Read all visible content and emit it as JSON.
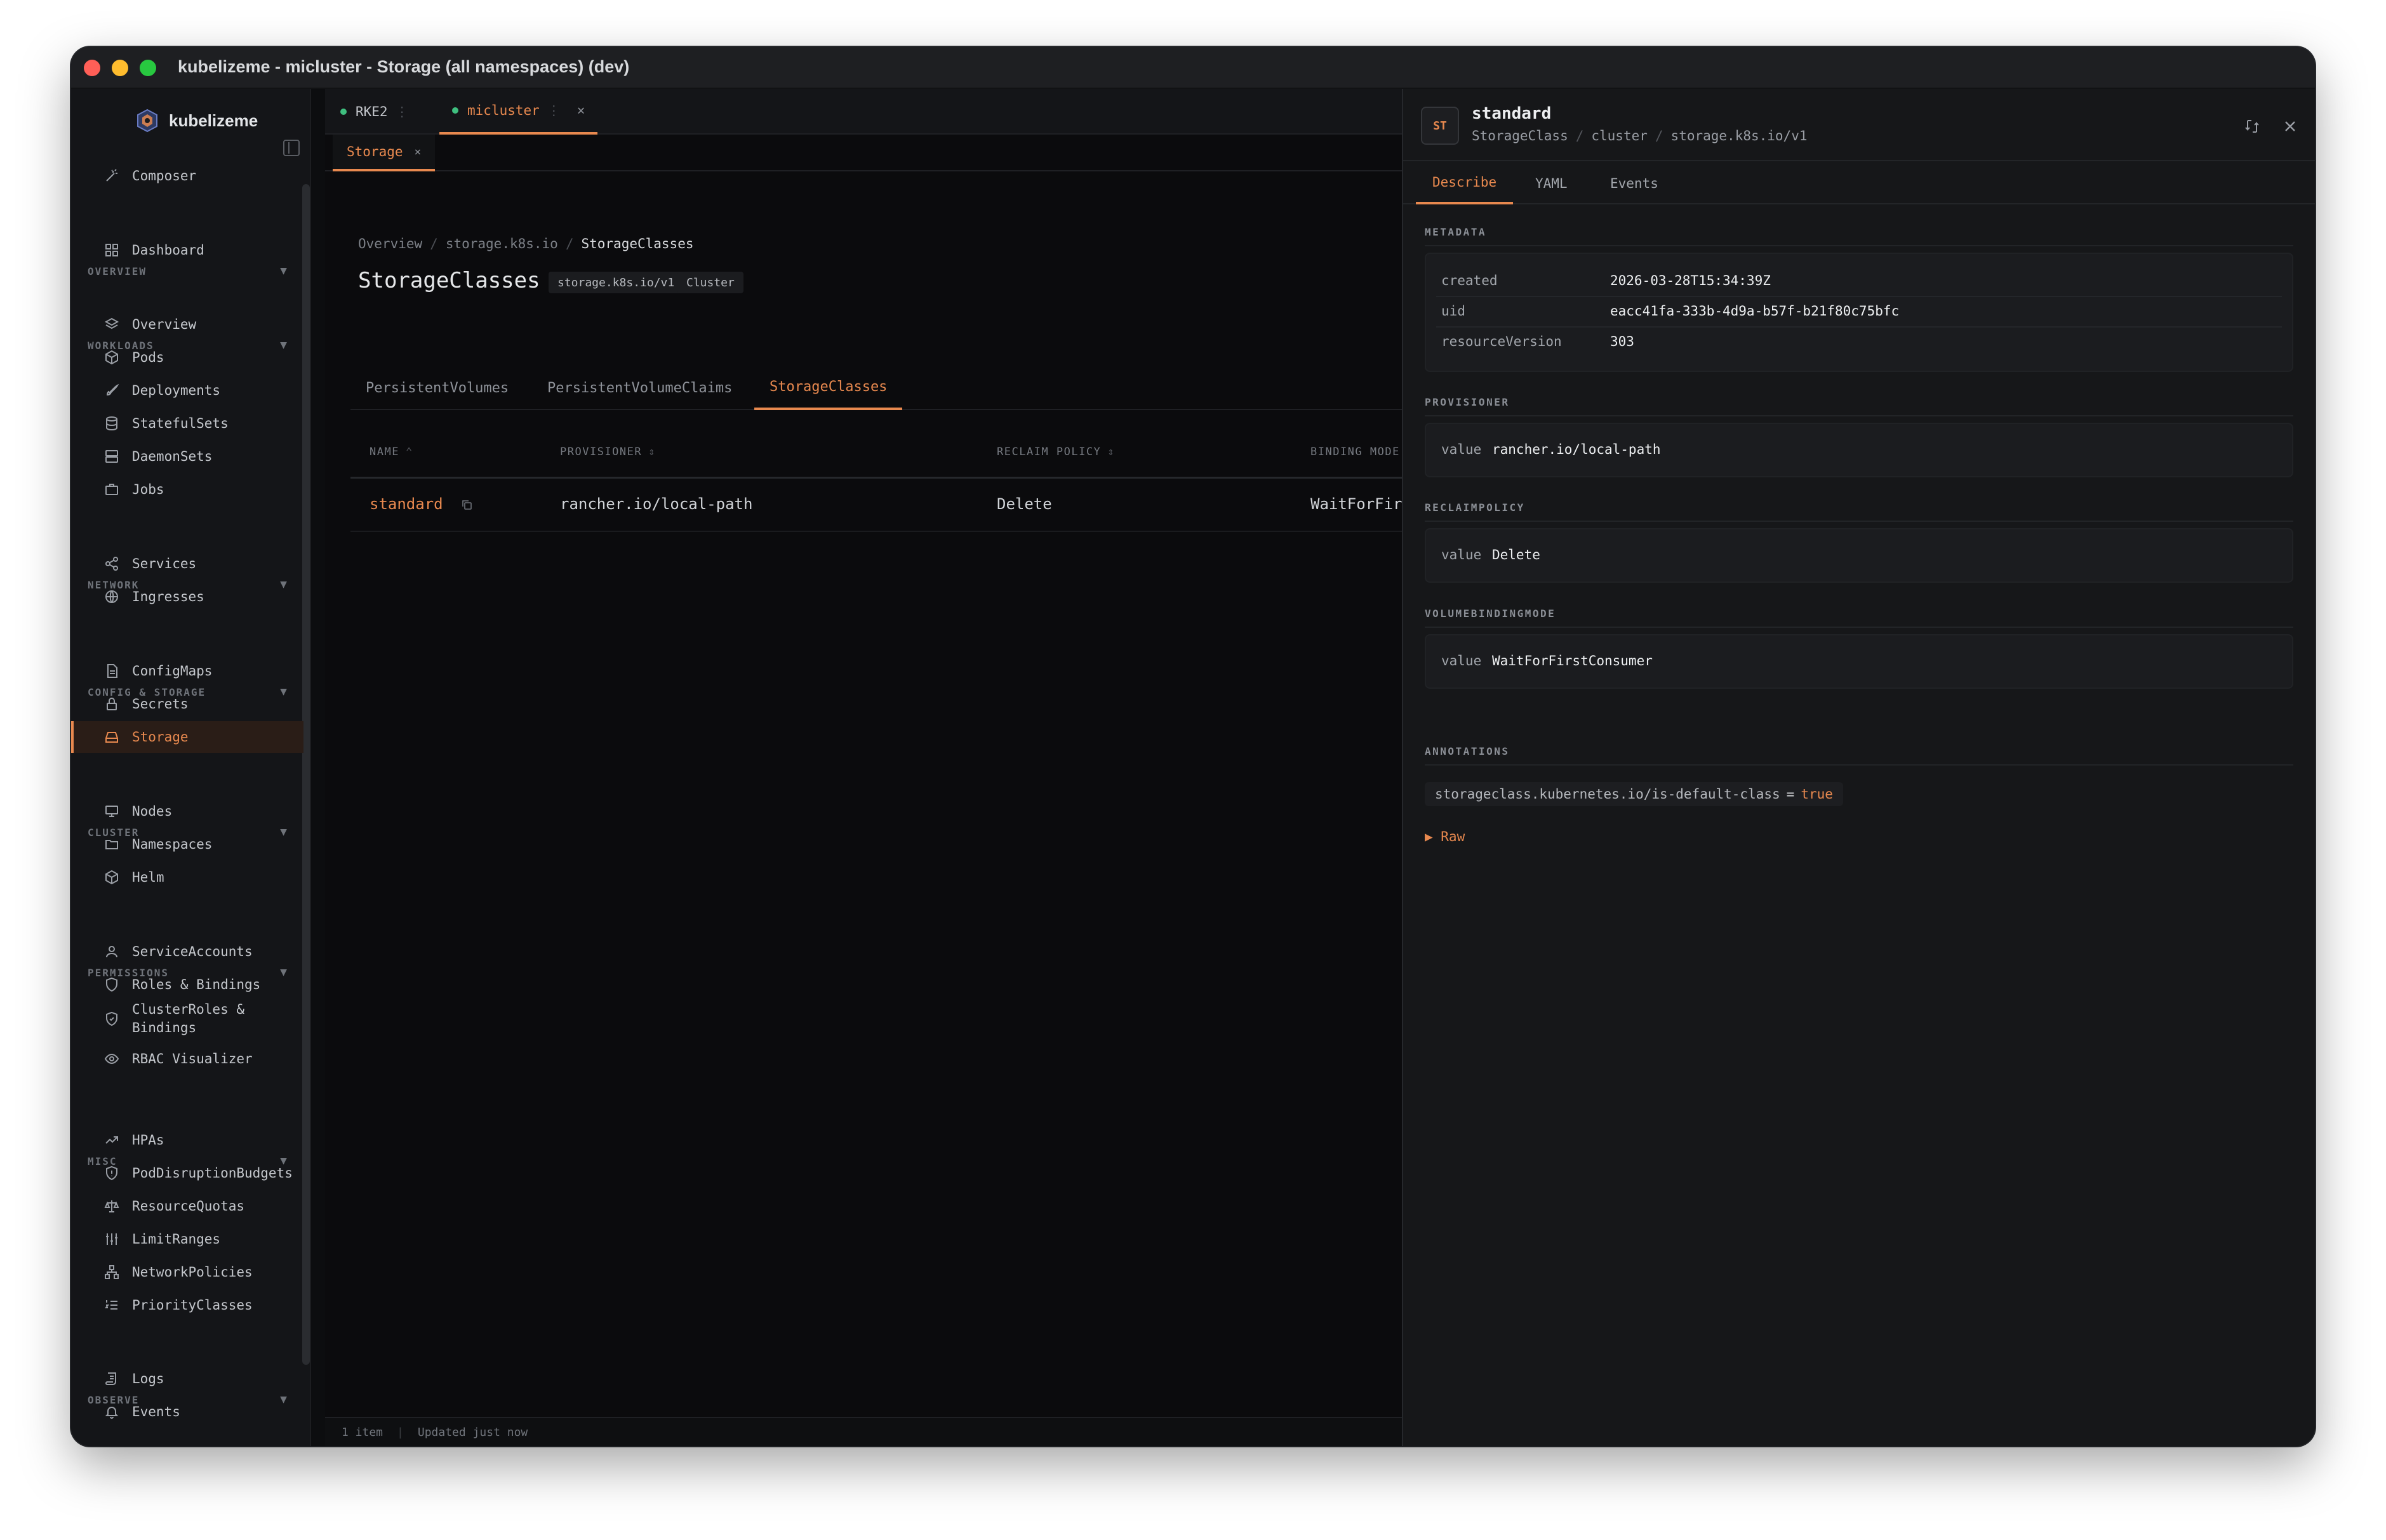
{
  "window": {
    "title": "kubelizeme - micluster - Storage (all namespaces) (dev)"
  },
  "brand": {
    "name": "kubelizeme"
  },
  "sidebar": {
    "composer": "Composer",
    "sections": {
      "overview": "OVERVIEW",
      "workloads": "WORKLOADS",
      "network": "NETWORK",
      "config": "CONFIG & STORAGE",
      "cluster": "CLUSTER",
      "permissions": "PERMISSIONS",
      "misc": "MISC",
      "observe": "OBSERVE"
    },
    "items": {
      "dashboard": "Dashboard",
      "overview": "Overview",
      "pods": "Pods",
      "deployments": "Deployments",
      "statefulsets": "StatefulSets",
      "daemonsets": "DaemonSets",
      "jobs": "Jobs",
      "services": "Services",
      "ingresses": "Ingresses",
      "configmaps": "ConfigMaps",
      "secrets": "Secrets",
      "storage": "Storage",
      "nodes": "Nodes",
      "namespaces": "Namespaces",
      "helm": "Helm",
      "serviceaccounts": "ServiceAccounts",
      "roles": "Roles & Bindings",
      "clusterroles_1": "ClusterRoles &",
      "clusterroles_2": "Bindings",
      "rbac": "RBAC Visualizer",
      "hpas": "HPAs",
      "pdb": "PodDisruptionBudgets",
      "quotas": "ResourceQuotas",
      "limitranges": "LimitRanges",
      "netpol": "NetworkPolicies",
      "priority": "PriorityClasses",
      "logs": "Logs",
      "events": "Events"
    }
  },
  "cluster_tabs": [
    {
      "label": "RKE2"
    },
    {
      "label": "micluster"
    }
  ],
  "sub_tab": {
    "label": "Storage"
  },
  "breadcrumb": {
    "a": "Overview",
    "b": "storage.k8s.io",
    "c": "StorageClasses"
  },
  "page": {
    "title": "StorageClasses",
    "badge_api": "storage.k8s.io/v1",
    "badge_scope": "Cluster"
  },
  "resource_tabs": [
    "PersistentVolumes",
    "PersistentVolumeClaims",
    "StorageClasses"
  ],
  "table": {
    "headers": {
      "name": "NAME",
      "provisioner": "PROVISIONER",
      "reclaim": "RECLAIM POLICY",
      "binding": "BINDING MODE"
    },
    "rows": [
      {
        "name": "standard",
        "provisioner": "rancher.io/local-path",
        "reclaim": "Delete",
        "binding": "WaitForFirstConsumer"
      }
    ]
  },
  "status": {
    "count": "1 item",
    "updated": "Updated just now"
  },
  "detail": {
    "icon": "ST",
    "title": "standard",
    "kind": "StorageClass",
    "scope": "cluster",
    "api": "storage.k8s.io/v1",
    "tabs": [
      "Describe",
      "YAML",
      "Events"
    ],
    "metadata_label": "METADATA",
    "metadata": {
      "created_k": "created",
      "created_v": "2026-03-28T15:34:39Z",
      "uid_k": "uid",
      "uid_v": "eacc41fa-333b-4d9a-b57f-b21f80c75bfc",
      "rv_k": "resourceVersion",
      "rv_v": "303"
    },
    "provisioner_label": "PROVISIONER",
    "provisioner_value": "rancher.io/local-path",
    "reclaim_label": "RECLAIMPOLICY",
    "reclaim_value": "Delete",
    "vbm_label": "VOLUMEBINDINGMODE",
    "vbm_value": "WaitForFirstConsumer",
    "value_key": "value",
    "annotations_label": "ANNOTATIONS",
    "annotation_key": "storageclass.kubernetes.io/is-default-class",
    "annotation_eq": "=",
    "annotation_value": "true",
    "raw_label": "▶ Raw"
  },
  "colors": {
    "accent": "#e8894f",
    "status_dot": "#3fbf7f",
    "bg": "#0b0b0d",
    "panel": "#161719"
  }
}
